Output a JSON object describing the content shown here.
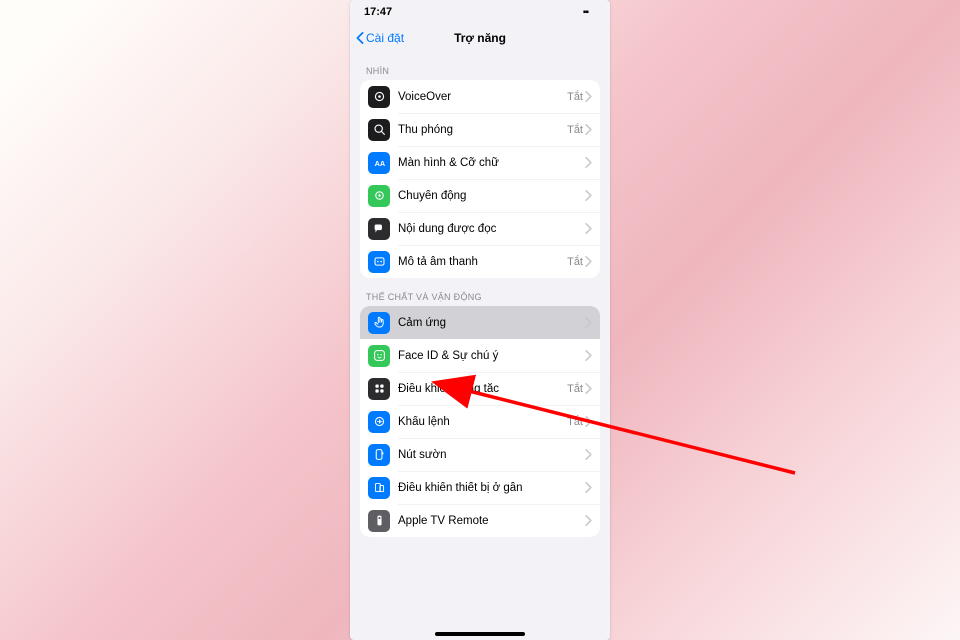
{
  "status": {
    "time": "17:47"
  },
  "nav": {
    "back": "Cài đặt",
    "title": "Trợ năng"
  },
  "sections": {
    "vision": {
      "header": "NHÌN",
      "items": [
        {
          "label": "VoiceOver",
          "value": "Tắt"
        },
        {
          "label": "Thu phóng",
          "value": "Tắt"
        },
        {
          "label": "Màn hình & Cỡ chữ"
        },
        {
          "label": "Chuyển động"
        },
        {
          "label": "Nội dung được đọc"
        },
        {
          "label": "Mô tả âm thanh",
          "value": "Tắt"
        }
      ]
    },
    "physical": {
      "header": "THỂ CHẤT VÀ VẬN ĐỘNG",
      "items": [
        {
          "label": "Cảm ứng"
        },
        {
          "label": "Face ID & Sự chú ý"
        },
        {
          "label": "Điều khiển công tắc",
          "value": "Tắt"
        },
        {
          "label": "Khẩu lệnh",
          "value": "Tắt"
        },
        {
          "label": "Nút sườn"
        },
        {
          "label": "Điều khiển thiết bị ở gần"
        },
        {
          "label": "Apple TV Remote"
        }
      ]
    }
  }
}
